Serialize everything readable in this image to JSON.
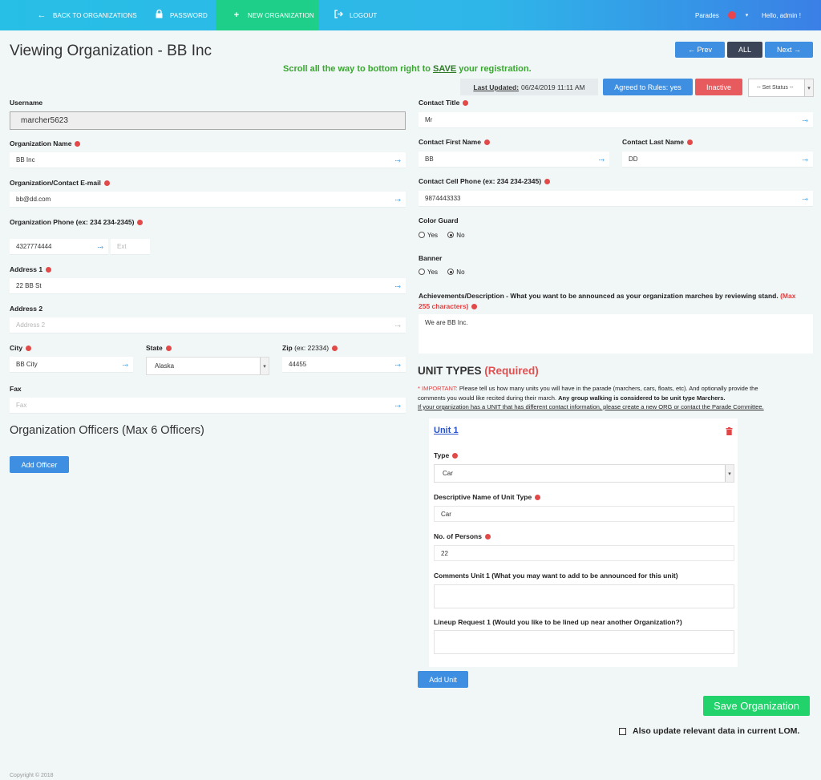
{
  "nav": {
    "back": "BACK TO ORGANIZATIONS",
    "password": "PASSWORD",
    "new_org": "NEW ORGANIZATION",
    "logout": "LOGOUT",
    "parades": "Parades",
    "user": "Hello, admin !"
  },
  "page": {
    "title": "Viewing Organization - BB Inc",
    "notice_prefix": "Scroll all the way to bottom right to ",
    "notice_save": "SAVE",
    "notice_suffix": " your registration.",
    "prev": "← Prev",
    "all": "ALL",
    "next": "Next →",
    "last_updated_label": "Last Updated:",
    "last_updated_value": "06/24/2019 11:11 AM",
    "agreed": "Agreed to Rules: yes",
    "inactive": "Inactive",
    "set_status": "-- Set Status --"
  },
  "left": {
    "username_label": "Username",
    "username_value": "marcher5623",
    "org_name_label": "Organization Name",
    "org_name_value": "BB Inc",
    "email_label": "Organization/Contact E-mail",
    "email_value": "bb@dd.com",
    "phone_label": "Organization Phone",
    "phone_hint": "(ex: 234 234-2345)",
    "phone_value": "4327774444",
    "ext_placeholder": "Ext",
    "address1_label": "Address 1",
    "address1_value": "22 BB St",
    "address2_label": "Address 2",
    "address2_placeholder": "Address 2",
    "city_label": "City",
    "city_value": "BB City",
    "state_label": "State",
    "state_value": "Alaska",
    "zip_label": "Zip",
    "zip_hint": "(ex: 22334)",
    "zip_value": "44455",
    "fax_label": "Fax",
    "fax_placeholder": "Fax",
    "officers_title": "Organization Officers (Max 6 Officers)",
    "add_officer": "Add Officer",
    "copyright": "Copyright © 2018"
  },
  "right": {
    "contact_title_label": "Contact Title",
    "contact_title_value": "Mr",
    "first_name_label": "Contact First Name",
    "first_name_value": "BB",
    "last_name_label": "Contact Last Name",
    "last_name_value": "DD",
    "cell_label": "Contact Cell Phone",
    "cell_hint": "(ex: 234 234-2345)",
    "cell_value": "9874443333",
    "color_guard_label": "Color Guard",
    "banner_label": "Banner",
    "yes": "Yes",
    "no": "No",
    "achievements_label": "Achievements/Description",
    "achievements_hint": " - What you want to be announced as your organization marches by reviewing stand. ",
    "achievements_max1": "(Max",
    "achievements_max2": "255 characters)",
    "achievements_value": "We are BB Inc.",
    "unit_types_title": "UNIT TYPES",
    "unit_types_required": "(Required)",
    "important_prefix": "* IMPORTANT:",
    "important_text": " Please tell us how many units you will have in the parade (marchers, cars, floats, etc). And optionally provide the",
    "important_text2": "comments you would like recited during their march. ",
    "important_bold": "Any group walking is considered to be unit type Marchers.",
    "important_link": "If your organization has a UNIT that has different contact information, please create a new ORG or contact the Parade Committee.",
    "add_unit": "Add Unit",
    "save_org": "Save Organization",
    "also_update": "Also update relevant data in current LOM."
  },
  "unit": {
    "title": "Unit 1",
    "type_label": "Type",
    "type_value": "Car",
    "desc_label": "Descriptive Name of Unit Type",
    "desc_value": "Car",
    "persons_label": "No. of Persons",
    "persons_value": "22",
    "comments_label": "Comments Unit",
    "comments_hint": " 1 (What you may want to add to be announced for this unit)",
    "lineup_label": "Lineup Request",
    "lineup_hint": " 1 (Would you like to be lined up near another Organization?)"
  }
}
